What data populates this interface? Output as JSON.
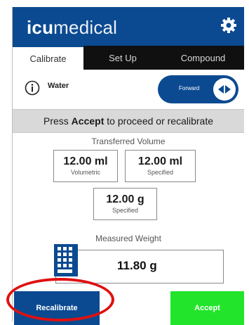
{
  "app": {
    "logo_bold": "icu",
    "logo_light": "medical"
  },
  "tabs": [
    {
      "label": "Calibrate",
      "active": true
    },
    {
      "label": "Set Up",
      "active": false
    },
    {
      "label": "Compound",
      "active": false
    }
  ],
  "fluid": {
    "name": "Water",
    "direction_label": "Forward"
  },
  "banner": {
    "prefix": "Press ",
    "bold": "Accept",
    "suffix": " to proceed or recalibrate"
  },
  "transferred": {
    "title": "Transferred Volume",
    "volumetric": {
      "value": "12.00 ml",
      "label": "Volumetric"
    },
    "specified_volume": {
      "value": "12.00 ml",
      "label": "Specified"
    },
    "specified_weight": {
      "value": "12.00 g",
      "label": "Specified"
    }
  },
  "measured": {
    "title": "Measured Weight",
    "value": "11.80 g"
  },
  "buttons": {
    "recalibrate": "Recalibrate",
    "accept": "Accept"
  },
  "colors": {
    "brand_blue": "#0b4a91",
    "accept_green": "#22e52b",
    "highlight_red": "#e01010"
  },
  "icons": [
    "gear-icon",
    "info-icon",
    "forward-icon",
    "scale-keypad-icon"
  ]
}
